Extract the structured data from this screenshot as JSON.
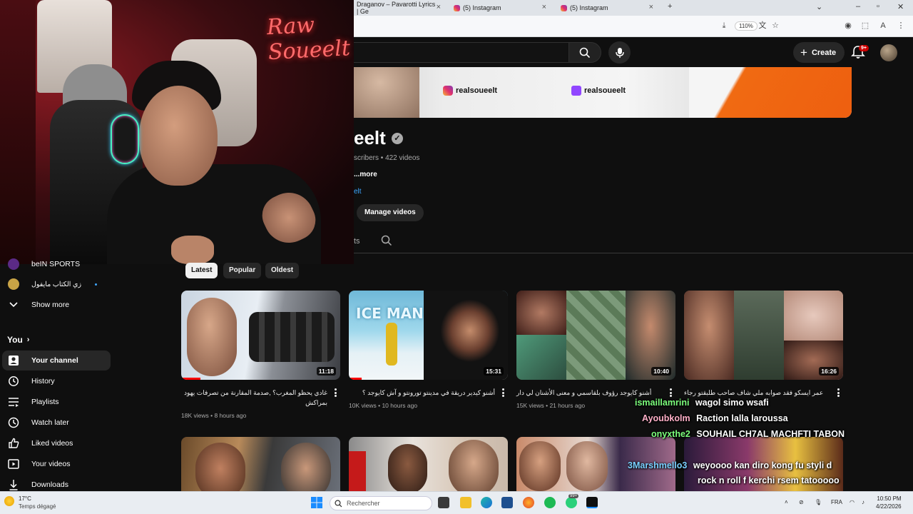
{
  "browser": {
    "tabs": [
      {
        "label": "Draganov – Pavarotti Lyrics | Ge"
      },
      {
        "label": "(5) Instagram"
      },
      {
        "label": "(5) Instagram"
      }
    ],
    "zoom": "110%"
  },
  "youtube": {
    "create_label": "Create",
    "notif_badge": "9+",
    "banner": {
      "instagram_handle": "realsoueelt",
      "twitch_handle": "realsoueelt"
    },
    "channel": {
      "name_partial": "eelt",
      "stats_partial": "scribers • 422 videos",
      "more_label": "...more",
      "link_partial": "elt",
      "manage_label": "Manage videos",
      "tab_partial": "ts"
    },
    "filters": [
      {
        "label": "Latest",
        "active": true
      },
      {
        "label": "Popular",
        "active": false
      },
      {
        "label": "Oldest",
        "active": false
      }
    ],
    "sidebar": {
      "subs": [
        {
          "label": "beIN SPORTS"
        },
        {
          "label": "زي الكتاب مايفول"
        }
      ],
      "show_more": "Show more",
      "you_label": "You",
      "items": [
        {
          "label": "Your channel",
          "icon": "person-icon"
        },
        {
          "label": "History",
          "icon": "history-icon"
        },
        {
          "label": "Playlists",
          "icon": "playlists-icon"
        },
        {
          "label": "Watch later",
          "icon": "clock-icon"
        },
        {
          "label": "Liked videos",
          "icon": "thumb-up-icon"
        },
        {
          "label": "Your videos",
          "icon": "video-icon"
        },
        {
          "label": "Downloads",
          "icon": "download-icon"
        }
      ]
    },
    "videos": [
      {
        "title": "غادي يحظو المغرب؟ ,صدمة المقارنة من تصرفات يهود بمراكش",
        "views": "18K views",
        "age": "8 hours ago",
        "duration": "11:18",
        "progress": 0.12
      },
      {
        "title": "أشنو كيدير دريقة في مدينتو تورونتو و آش كايوجد ؟",
        "views": "10K views",
        "age": "10 hours ago",
        "duration": "15:31",
        "progress": 0.08
      },
      {
        "title": "أشنو كايوجد رؤوف بلقاسمي و معنى الأشنان لي دار",
        "views": "15K views",
        "age": "21 hours ago",
        "duration": "10:40",
        "progress": 0.0
      },
      {
        "title": "عمر ايسكو فقد صوابه ملي شاف صاحب طلبقتو رجاء",
        "views": "",
        "age": "",
        "duration": "16:26",
        "progress": 0.0
      }
    ]
  },
  "chat": [
    {
      "user": "ismaillamrini",
      "msg": "wagol simo wsafi",
      "user_color": "#7cff7c"
    },
    {
      "user": "Ayoubkolm",
      "msg": "Raction lalla laroussa",
      "user_color": "#ffb0c8"
    },
    {
      "user": "onyxthe2",
      "msg": "SOUHAIL CH7AL MACHFTI TABON",
      "user_color": "#7cff7c"
    },
    {
      "user": "3Marshmello3",
      "msg": "weyoooo kan diro kong fu styli d",
      "user_color": "#7ad0ff"
    },
    {
      "user": "",
      "msg": "rock n roll f kerchi rsem tatooooo",
      "user_color": "#ffffff"
    }
  ],
  "taskbar": {
    "temp": "17°C",
    "weather": "Temps dégagé",
    "search_placeholder": "Rechercher",
    "lang": "FRA",
    "time": "10:50 PM",
    "date": "4/22/2026",
    "badge": "99+"
  }
}
